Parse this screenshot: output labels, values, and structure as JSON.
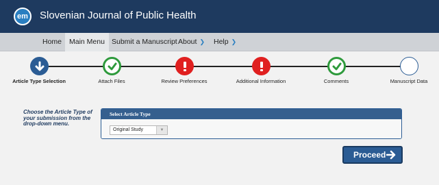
{
  "header": {
    "logo_text": "em",
    "title": "Slovenian Journal of Public Health"
  },
  "nav": {
    "home": "Home",
    "main_menu": "Main Menu",
    "submit": "Submit a Manuscript",
    "about": "About",
    "help": "Help"
  },
  "steps": [
    {
      "label": "Article Type Selection",
      "status": "current",
      "icon": "arrow-down-icon"
    },
    {
      "label": "Attach Files",
      "status": "complete",
      "icon": "check-icon"
    },
    {
      "label": "Review Preferences",
      "status": "error",
      "icon": "exclamation-icon"
    },
    {
      "label": "Additional Information",
      "status": "error",
      "icon": "exclamation-icon"
    },
    {
      "label": "Comments",
      "status": "complete",
      "icon": "check-icon"
    },
    {
      "label": "Manuscript Data",
      "status": "pending",
      "icon": "empty-circle-icon"
    }
  ],
  "content": {
    "instructions": "Choose the Article Type of your submission from the drop-down menu.",
    "panel_title": "Select Article Type",
    "selected_type": "Original Study",
    "proceed_label": "Proceed"
  },
  "colors": {
    "header_bg": "#1e3a5f",
    "nav_bg": "#cfd2d6",
    "accent": "#2b5c94",
    "complete": "#2e9a3c",
    "error": "#e02020"
  }
}
